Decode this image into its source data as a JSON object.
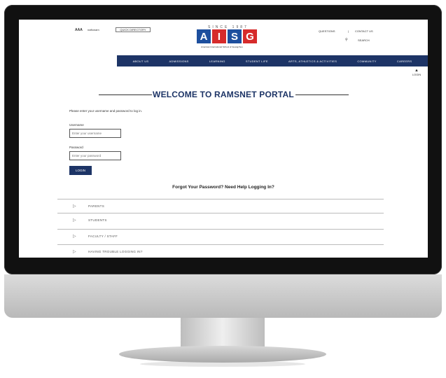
{
  "topbar": {
    "aasa_logo": "AAA",
    "partner_logo": "naftonam",
    "quick_button": "QUICK DIRECTORY",
    "right_links": [
      "QUESTIONS",
      "|",
      "CONTACT US"
    ],
    "search_label": "SEARCH"
  },
  "logo": {
    "since": "SINCE 1987",
    "letters": [
      "A",
      "I",
      "S",
      "G"
    ],
    "tagline": "American International School of Guangzhou",
    "colors": [
      "#1d4f9e",
      "#d62b2b",
      "#1d4f9e",
      "#d62b2b"
    ]
  },
  "nav": {
    "items": [
      "ABOUT US",
      "ADMISSIONS",
      "LEARNING",
      "STUDENT LIFE",
      "ARTS, ATHLETICS & ACTIVITIES",
      "COMMUNITY",
      "CAREERS"
    ]
  },
  "login_link": "LOGIN",
  "headline": "WELCOME TO RAMSNET PORTAL",
  "instructions": "Please enter your username and password to log in.",
  "form": {
    "username_label": "Username",
    "username_placeholder": "Enter your username",
    "password_label": "Password",
    "password_placeholder": "Enter your password",
    "login_button": "LOGIN"
  },
  "forgot": "Forgot Your Password? Need Help Logging In?",
  "accordion": [
    {
      "label": "PARENTS"
    },
    {
      "label": "STUDENTS"
    },
    {
      "label": "FACULTY / STAFF"
    },
    {
      "label": "HAVING TROUBLE LOGGING IN?"
    }
  ],
  "colors": {
    "brand_navy": "#1d3466",
    "logo_blue": "#1d4f9e",
    "logo_red": "#d62b2b"
  }
}
